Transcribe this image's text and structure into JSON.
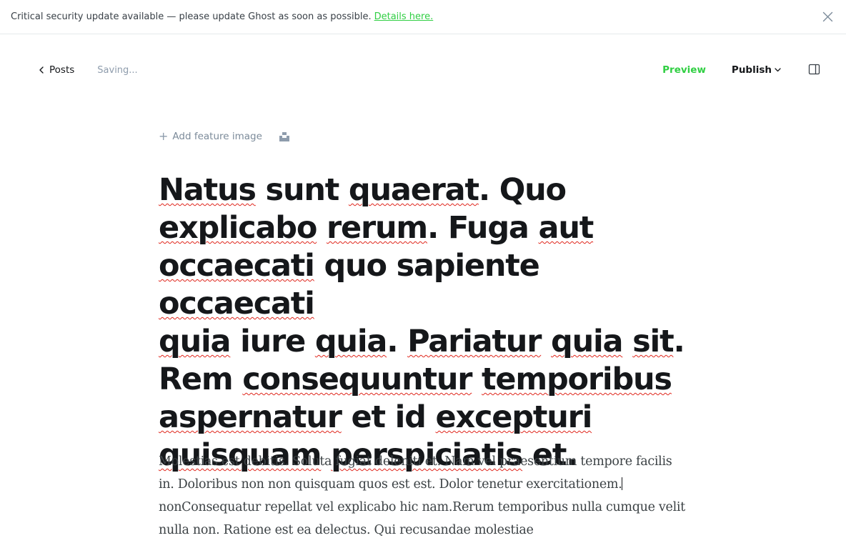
{
  "banner": {
    "message": "Critical security update available — please update Ghost as soon as possible.",
    "link_label": "Details here.",
    "close_icon": "close-icon"
  },
  "toolbar": {
    "back_label": "Posts",
    "status": "Saving...",
    "preview_label": "Preview",
    "publish_label": "Publish",
    "sidebar_icon": "sidebar-toggle-icon"
  },
  "editor": {
    "add_feature_label": "Add feature image",
    "title_lines": [
      [
        {
          "t": "Natus",
          "sp": true
        },
        {
          "t": " sunt ",
          "sp": false
        },
        {
          "t": "quaerat",
          "sp": true
        },
        {
          "t": ". Quo",
          "sp": false
        }
      ],
      [
        {
          "t": "explicabo",
          "sp": true
        },
        {
          "t": " ",
          "sp": false
        },
        {
          "t": "rerum",
          "sp": true
        },
        {
          "t": ". Fuga ",
          "sp": false
        },
        {
          "t": "aut",
          "sp": true
        }
      ],
      [
        {
          "t": "occaecati",
          "sp": true
        },
        {
          "t": " quo sapiente ",
          "sp": false
        },
        {
          "t": "occaecati",
          "sp": true
        }
      ],
      [
        {
          "t": "quia",
          "sp": true
        },
        {
          "t": " iure ",
          "sp": false
        },
        {
          "t": "quia",
          "sp": true
        },
        {
          "t": ". ",
          "sp": false
        },
        {
          "t": "Pariatur",
          "sp": true
        },
        {
          "t": " ",
          "sp": false
        },
        {
          "t": "quia",
          "sp": true
        },
        {
          "t": " ",
          "sp": false
        },
        {
          "t": "sit",
          "sp": true
        },
        {
          "t": ".",
          "sp": false
        }
      ],
      [
        {
          "t": "Rem ",
          "sp": false
        },
        {
          "t": "consequuntur",
          "sp": true
        },
        {
          "t": " ",
          "sp": false
        },
        {
          "t": "temporibus",
          "sp": true
        }
      ],
      [
        {
          "t": "aspernatur",
          "sp": true
        },
        {
          "t": " et id ",
          "sp": false
        },
        {
          "t": "excepturi",
          "sp": true
        }
      ],
      [
        {
          "t": "quisquam",
          "sp": true
        },
        {
          "t": " ",
          "sp": false
        },
        {
          "t": "perspiciatis",
          "sp": true
        },
        {
          "t": " et.",
          "sp": false
        }
      ]
    ],
    "body_before_caret": "Molestias est debitis. Soluta fugiat deleniti et. Nam vel praesentium tempore facilis in. Doloribus non non quisquam quos est est. Dolor tenetur exercitationem.",
    "body_after_caret": "nonConsequatur repellat vel explicabo hic nam.Rerum temporibus nulla cumque velit nulla non. Ratione est ea delectus. Qui recusandae molestiae"
  }
}
